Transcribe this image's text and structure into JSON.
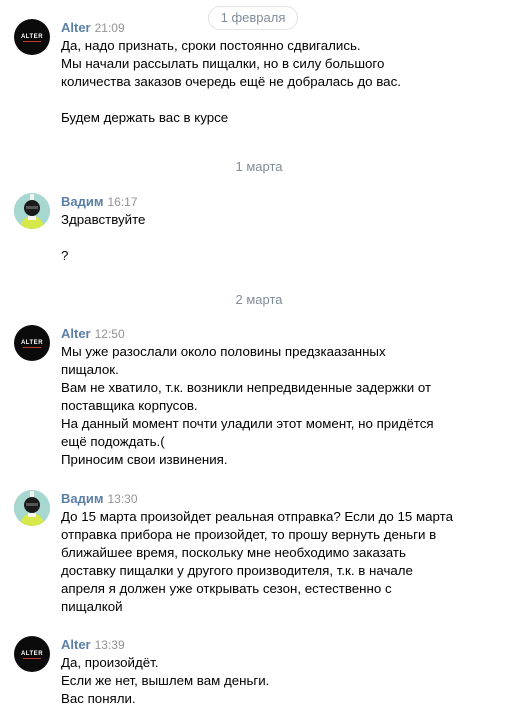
{
  "dates": {
    "d1": "1 февраля",
    "d2": "1 марта",
    "d3": "2 марта"
  },
  "messages": [
    {
      "author": "Alter",
      "time": "21:09",
      "text": "Да, надо признать, сроки постоянно сдвигались.\nМы начали рассылать пищалки, но в силу большого\nколичества заказов очередь ещё не добралась до вас.\n\nБудем держать вас в курсе"
    },
    {
      "author": "Вадим",
      "time": "16:17",
      "text": "Здравствуйте\n\n?"
    },
    {
      "author": "Alter",
      "time": "12:50",
      "text": "Мы уже разослали около половины предзкаазанных\nпищалок.\nВам не хватило, т.к. возникли непредвиденные задержки от\nпоставщика корпусов.\nНа данный момент почти уладили этот момент, но придётся\nещё подождать.(\nПриносим свои извинения."
    },
    {
      "author": "Вадим",
      "time": "13:30",
      "text": "До 15 марта произойдет реальная отправка? Если до 15 марта\nотправка прибора не произойдет, то прошу вернуть деньги в\nближайшее время, поскольку мне необходимо заказать\nдоставку пищалки у другого производителя, т.к. в начале\nапреля я должен уже открывать сезон, естественно с\nпищалкой"
    },
    {
      "author": "Alter",
      "time": "13:39",
      "text": "Да, произойдёт.\nЕсли же нет, вышлем вам деньги.\nВас поняли."
    }
  ],
  "avatars": {
    "alter_logo": "ALTER"
  },
  "colors": {
    "author": "#5b7fa6",
    "time": "#939393",
    "date": "#818c99"
  }
}
